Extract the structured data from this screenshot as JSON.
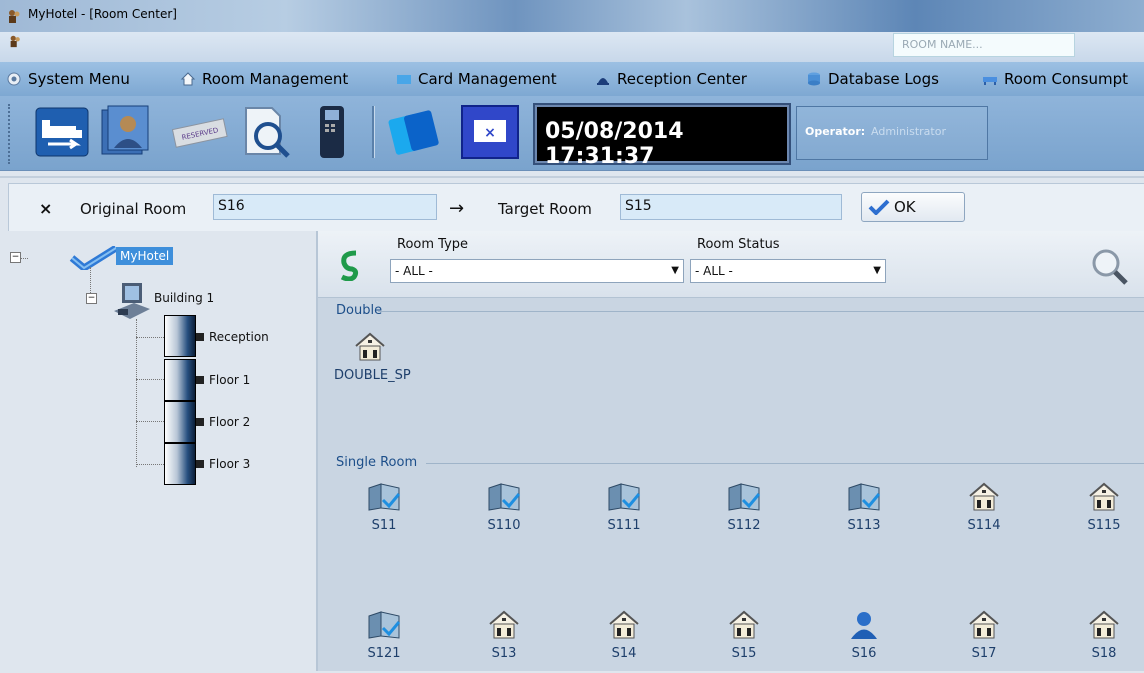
{
  "window": {
    "title": "MyHotel - [Room Center]"
  },
  "menu": {
    "items": [
      {
        "label": "System Menu",
        "icon": "gear-icon"
      },
      {
        "label": "Room Management",
        "icon": "home-icon"
      },
      {
        "label": "Card Management",
        "icon": "card-icon"
      },
      {
        "label": "Reception Center",
        "icon": "bell-icon"
      },
      {
        "label": "Database Logs",
        "icon": "database-icon"
      },
      {
        "label": "Room Consumpt",
        "icon": "sofa-icon"
      }
    ]
  },
  "toolbar": {
    "clock": "05/08/2014 17:31:37",
    "operator_label": "Operator:",
    "operator_value": "Administrator",
    "reserved_label": "RESERVED"
  },
  "change_room": {
    "close_glyph": "×",
    "original_label": "Original Room",
    "original_value": "S16",
    "arrow": "→",
    "target_label": "Target Room",
    "target_value": "S15",
    "ok_label": "OK"
  },
  "tree": {
    "root": "MyHotel",
    "building": "Building 1",
    "floors": [
      "Reception",
      "Floor 1",
      "Floor 2",
      "Floor 3"
    ]
  },
  "filters": {
    "room_type_label": "Room Type",
    "room_type_value": "- ALL -",
    "room_status_label": "Room Status",
    "room_status_value": "- ALL -",
    "search_placeholder": "ROOM NAME..."
  },
  "groups": {
    "double": {
      "label": "Double",
      "rooms": [
        {
          "name": "DOUBLE_SP",
          "status": "vacant"
        }
      ]
    },
    "single": {
      "label": "Single Room",
      "rooms": [
        {
          "name": "S11",
          "status": "dirty"
        },
        {
          "name": "S110",
          "status": "dirty"
        },
        {
          "name": "S111",
          "status": "dirty"
        },
        {
          "name": "S112",
          "status": "dirty"
        },
        {
          "name": "S113",
          "status": "dirty"
        },
        {
          "name": "S114",
          "status": "vacant"
        },
        {
          "name": "S115",
          "status": "vacant"
        },
        {
          "name": "S121",
          "status": "dirty"
        },
        {
          "name": "S13",
          "status": "vacant"
        },
        {
          "name": "S14",
          "status": "vacant"
        },
        {
          "name": "S15",
          "status": "vacant"
        },
        {
          "name": "S16",
          "status": "occupied"
        },
        {
          "name": "S17",
          "status": "vacant"
        },
        {
          "name": "S18",
          "status": "vacant"
        }
      ]
    }
  }
}
